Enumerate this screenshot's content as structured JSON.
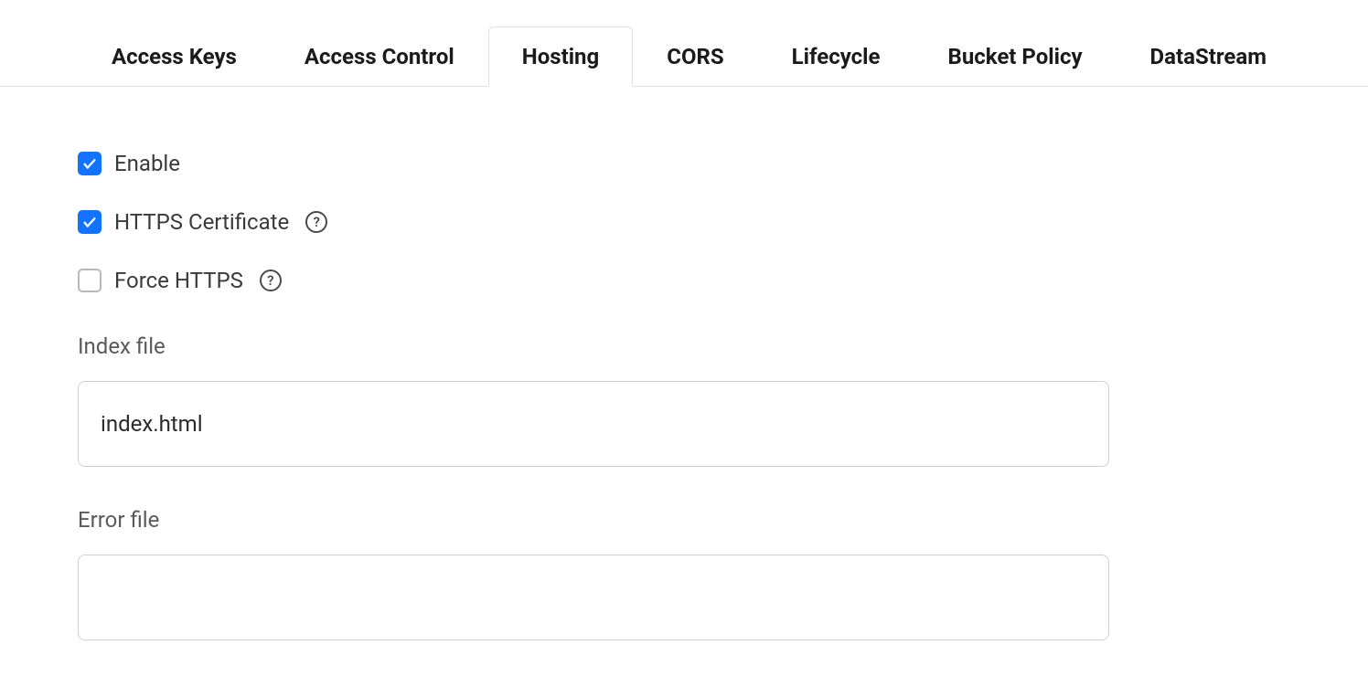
{
  "tabs": [
    {
      "label": "Access Keys",
      "active": false
    },
    {
      "label": "Access Control",
      "active": false
    },
    {
      "label": "Hosting",
      "active": true
    },
    {
      "label": "CORS",
      "active": false
    },
    {
      "label": "Lifecycle",
      "active": false
    },
    {
      "label": "Bucket Policy",
      "active": false
    },
    {
      "label": "DataStream",
      "active": false
    }
  ],
  "hosting": {
    "enable": {
      "label": "Enable",
      "checked": true
    },
    "https_certificate": {
      "label": "HTTPS Certificate",
      "checked": true,
      "has_help": true
    },
    "force_https": {
      "label": "Force HTTPS",
      "checked": false,
      "has_help": true
    },
    "index_file": {
      "label": "Index file",
      "value": "index.html"
    },
    "error_file": {
      "label": "Error file",
      "value": ""
    }
  }
}
